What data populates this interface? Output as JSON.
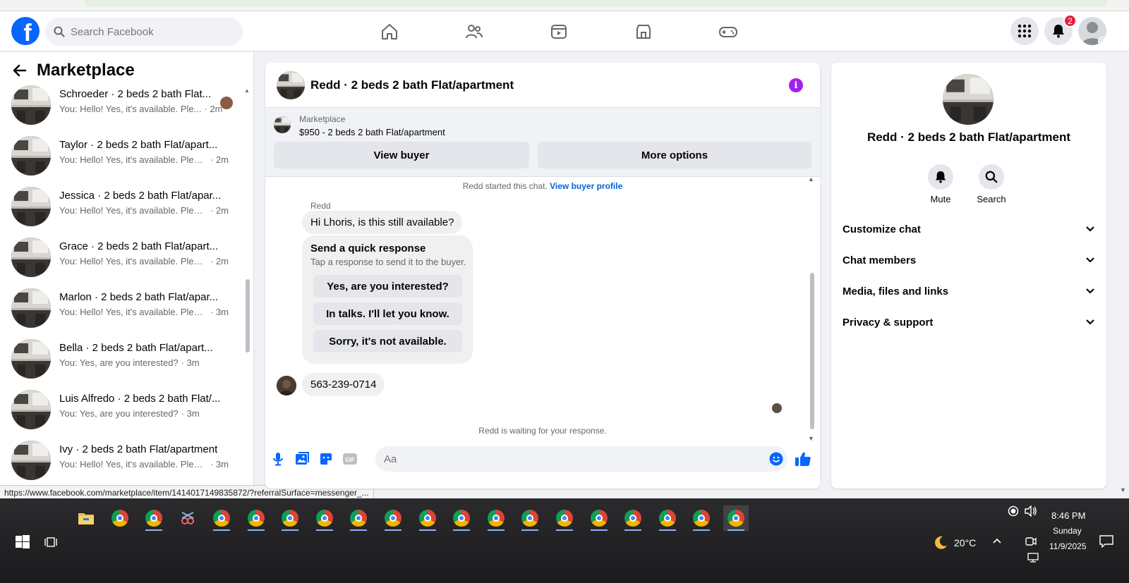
{
  "search": {
    "placeholder": "Search Facebook"
  },
  "notifications": {
    "count": "2"
  },
  "sidebar": {
    "title": "Marketplace",
    "conversations": [
      {
        "title": "Schroeder · 2 beds 2 bath Flat...",
        "preview": "You: Hello! Yes, it's available. Ple...",
        "time": "· 2m",
        "seen": true
      },
      {
        "title": "Taylor · 2 beds 2 bath Flat/apart...",
        "preview": "You: Hello! Yes, it's available. Pleas...",
        "time": "· 2m"
      },
      {
        "title": "Jessica · 2 beds 2 bath Flat/apar...",
        "preview": "You: Hello! Yes, it's available. Pleas...",
        "time": "· 2m"
      },
      {
        "title": "Grace · 2 beds 2 bath Flat/apart...",
        "preview": "You: Hello! Yes, it's available. Pleas...",
        "time": "· 2m"
      },
      {
        "title": "Marlon · 2 beds 2 bath Flat/apar...",
        "preview": "You: Hello! Yes, it's available. Pleas...",
        "time": "· 3m"
      },
      {
        "title": "Bella · 2 beds 2 bath Flat/apart...",
        "preview": "You: Yes, are you interested?",
        "time": "· 3m"
      },
      {
        "title": "Luis Alfredo · 2 beds 2 bath Flat/...",
        "preview": "You: Yes, are you interested?",
        "time": "· 3m"
      },
      {
        "title": "Ivy · 2 beds 2 bath Flat/apartment",
        "preview": "You: Hello! Yes, it's available. Pleas...",
        "time": "· 3m"
      }
    ]
  },
  "status_url": "https://www.facebook.com/marketplace/item/1414017149835872/?referralSurface=messenger_...",
  "chat": {
    "title": "Redd · 2 beds 2 bath Flat/apartment",
    "marketplace_label": "Marketplace",
    "listing": "$950 - 2 beds 2 bath Flat/apartment",
    "view_buyer": "View buyer",
    "more_options": "More options",
    "started_text": "Redd started this chat.",
    "buyer_profile_link": "View buyer profile",
    "sender_name": "Redd",
    "message_1": "Hi Lhoris, is this still available?",
    "quick_title": "Send a quick response",
    "quick_sub": "Tap a response to send it to the buyer.",
    "quick_responses": [
      "Yes, are you interested?",
      "In talks. I'll let you know.",
      "Sorry, it's not available."
    ],
    "message_2": "563-239-0714",
    "waiting_text": "Redd is waiting for your response.",
    "composer_placeholder": "Aa"
  },
  "details": {
    "name": "Redd · 2 beds 2 bath Flat/apartment",
    "mute": "Mute",
    "search": "Search",
    "sections": [
      "Customize chat",
      "Chat members",
      "Media, files and links",
      "Privacy & support"
    ]
  },
  "taskbar": {
    "weather": "20°C",
    "time": "8:46 PM",
    "day": "Sunday",
    "date": "11/9/2025"
  },
  "colors": {
    "brand": "#0866ff",
    "info": "#a020f0",
    "badge": "#e41e3f"
  }
}
